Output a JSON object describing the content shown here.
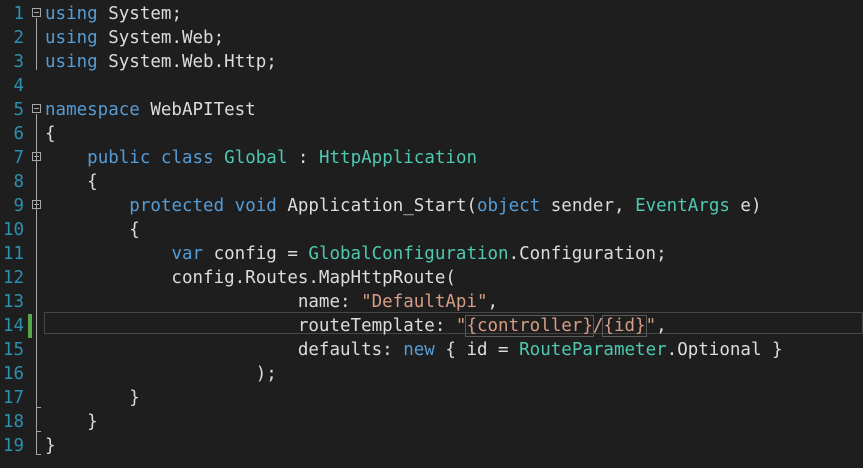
{
  "editor": {
    "colors": {
      "background": "#1e1e1e",
      "line_number": "#2b91af",
      "keyword": "#569cd6",
      "type": "#4ec9b0",
      "string": "#d69d85",
      "plain": "#dcdcdc",
      "change_marker": "#57a64a"
    },
    "active_line": "14",
    "lines": [
      {
        "num": "1",
        "t": [
          "using",
          " System;"
        ]
      },
      {
        "num": "2",
        "t": [
          "using",
          " System.Web;"
        ]
      },
      {
        "num": "3",
        "t": [
          "using",
          " System.Web.Http;"
        ]
      },
      {
        "num": "4",
        "t": []
      },
      {
        "num": "5",
        "t": [
          "namespace",
          " WebAPITest"
        ]
      },
      {
        "num": "6",
        "t": [
          "{"
        ]
      },
      {
        "num": "7",
        "t": [
          "    ",
          "public",
          " ",
          "class",
          " ",
          "Global",
          " : ",
          "HttpApplication"
        ]
      },
      {
        "num": "8",
        "t": [
          "    {"
        ]
      },
      {
        "num": "9",
        "t": [
          "        ",
          "protected",
          " ",
          "void",
          " Application_Start(",
          "object",
          " sender, ",
          "EventArgs",
          " e)"
        ]
      },
      {
        "num": "10",
        "t": [
          "        {"
        ]
      },
      {
        "num": "11",
        "t": [
          "            ",
          "var",
          " config = ",
          "GlobalConfiguration",
          ".Configuration;"
        ]
      },
      {
        "num": "12",
        "t": [
          "            config.Routes.MapHttpRoute("
        ]
      },
      {
        "num": "13",
        "t": [
          "                        name: ",
          "\"DefaultApi\"",
          ","
        ]
      },
      {
        "num": "14",
        "t": [
          "                        routeTemplate: ",
          "\"",
          "{controller}",
          "/",
          "{id}",
          "\"",
          ","
        ]
      },
      {
        "num": "15",
        "t": [
          "                        defaults: ",
          "new",
          " { id = ",
          "RouteParameter",
          ".Optional }"
        ]
      },
      {
        "num": "16",
        "t": [
          "                    );"
        ]
      },
      {
        "num": "17",
        "t": [
          "        }"
        ]
      },
      {
        "num": "18",
        "t": [
          "    }"
        ]
      },
      {
        "num": "19",
        "t": [
          "}"
        ]
      }
    ]
  }
}
